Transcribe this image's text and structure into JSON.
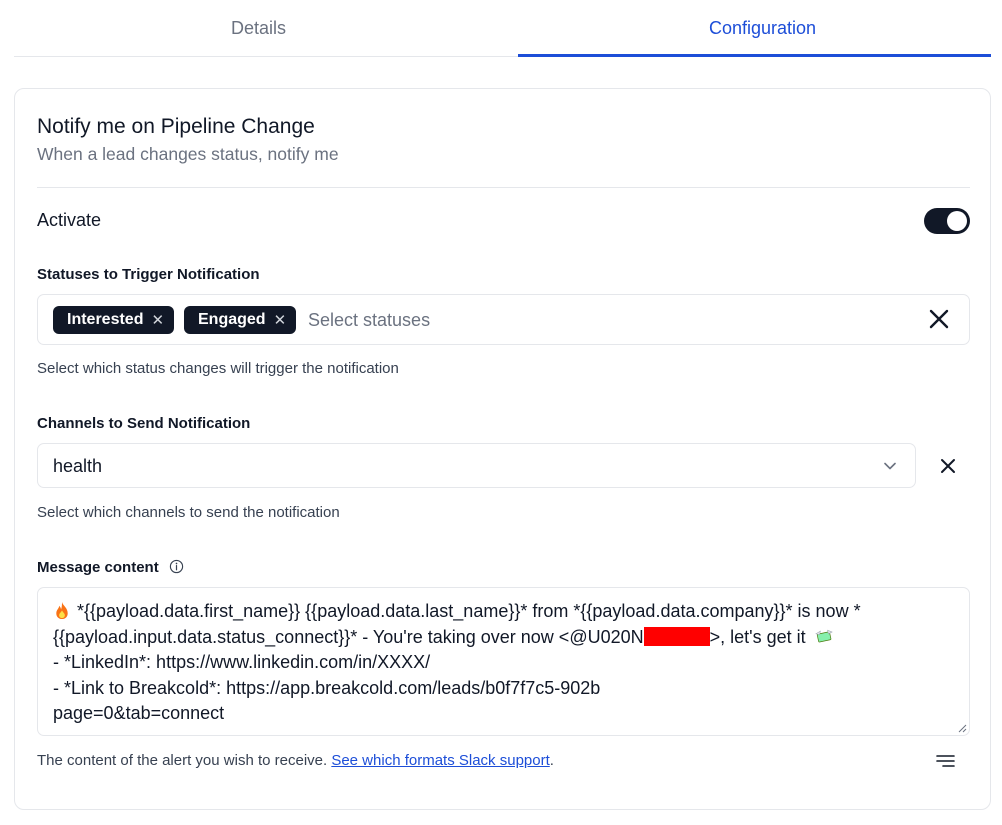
{
  "tabs": {
    "details": "Details",
    "configuration": "Configuration",
    "active": "configuration"
  },
  "card": {
    "title": "Notify me on Pipeline Change",
    "subtitle": "When a lead changes status, notify me"
  },
  "activate": {
    "label": "Activate",
    "enabled": true
  },
  "statuses": {
    "label": "Statuses to Trigger Notification",
    "chips": [
      "Interested",
      "Engaged"
    ],
    "placeholder": "Select statuses",
    "help": "Select which status changes will trigger the notification"
  },
  "channels": {
    "label": "Channels to Send Notification",
    "value": "health",
    "help": "Select which channels to send the notification"
  },
  "message": {
    "label": "Message content",
    "line1": "*{{payload.data.first_name}} {{payload.data.last_name}}* from *{{payload.data.company}}* is now *",
    "line2_before": "{{payload.input.data.status_connect}}* - You're taking over now <@U020N",
    "line2_after": ">, let's get it",
    "line3": "- *LinkedIn*: https://www.linkedin.com/in/XXXX/",
    "line4": "- *Link to Breakcold*: https://app.breakcold.com/leads/b0f7f7c5-902b",
    "line5": "page=0&tab=connect"
  },
  "footer": {
    "help_text": "The content of the alert you wish to receive. ",
    "link_text": "See which formats Slack support",
    "trailing": "."
  },
  "colors": {
    "accent": "#1d4ed8",
    "dark": "#111827",
    "border": "#e5e7eb",
    "redaction": "#ff0000"
  },
  "icons": [
    "close-icon",
    "chevron-down-icon",
    "info-icon",
    "fire-icon",
    "money-with-wings-icon",
    "resize-handle-icon",
    "text-format-icon"
  ]
}
